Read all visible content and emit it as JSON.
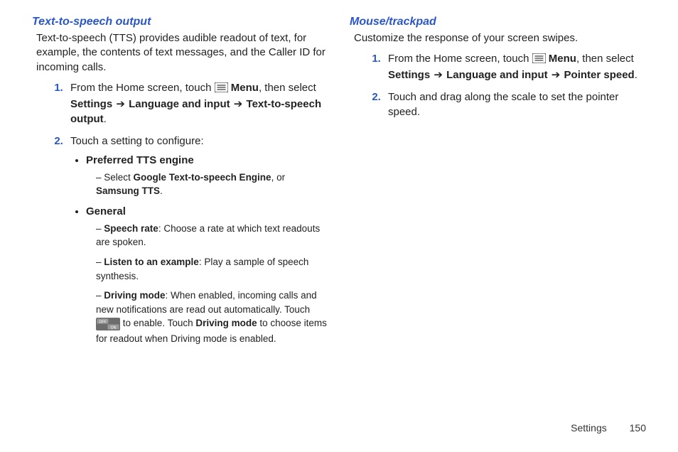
{
  "left": {
    "heading": "Text-to-speech output",
    "intro": "Text-to-speech (TTS) provides audible readout of text, for example, the contents of text messages, and the Caller ID for incoming calls.",
    "step1_a": "From the Home screen, touch ",
    "step1_menu": " Menu",
    "step1_b": ", then select ",
    "step1_settings": "Settings",
    "arrow": "➔",
    "step1_lang": "Language and input",
    "step1_tts": "Text-to-speech output",
    "period": ".",
    "step2": "Touch a setting to configure:",
    "b1": "Preferred TTS engine",
    "b1d1_a": "Select ",
    "b1d1_b": "Google Text-to-speech Engine",
    "b1d1_c": ", or ",
    "b1d1_d": "Samsung TTS",
    "b2": "General",
    "b2d1_k": "Speech rate",
    "b2d1_v": ": Choose a rate at which text readouts are spoken.",
    "b2d2_k": "Listen to an example",
    "b2d2_v": ": Play a sample of speech synthesis.",
    "b2d3_k": "Driving mode",
    "b2d3_a": ": When enabled, incoming calls and new notifications are read out automatically. Touch ",
    "b2d3_b": " to enable. Touch ",
    "b2d3_c": "Driving mode",
    "b2d3_d": " to choose items for readout when Driving mode is enabled."
  },
  "right": {
    "heading": "Mouse/trackpad",
    "intro": "Customize the response of your screen swipes.",
    "step1_a": "From the Home screen, touch ",
    "step1_menu": " Menu",
    "step1_b": ", then select ",
    "step1_settings": "Settings",
    "arrow": "➔",
    "step1_lang": "Language and input",
    "step1_ptr": "Pointer speed",
    "period": ".",
    "step2": "Touch and drag along the scale to set the pointer speed."
  },
  "footer": {
    "section": "Settings",
    "page": "150"
  },
  "icons": {
    "menu": "menu-icon",
    "toggle_off": "OFF",
    "toggle_on": "ON"
  }
}
